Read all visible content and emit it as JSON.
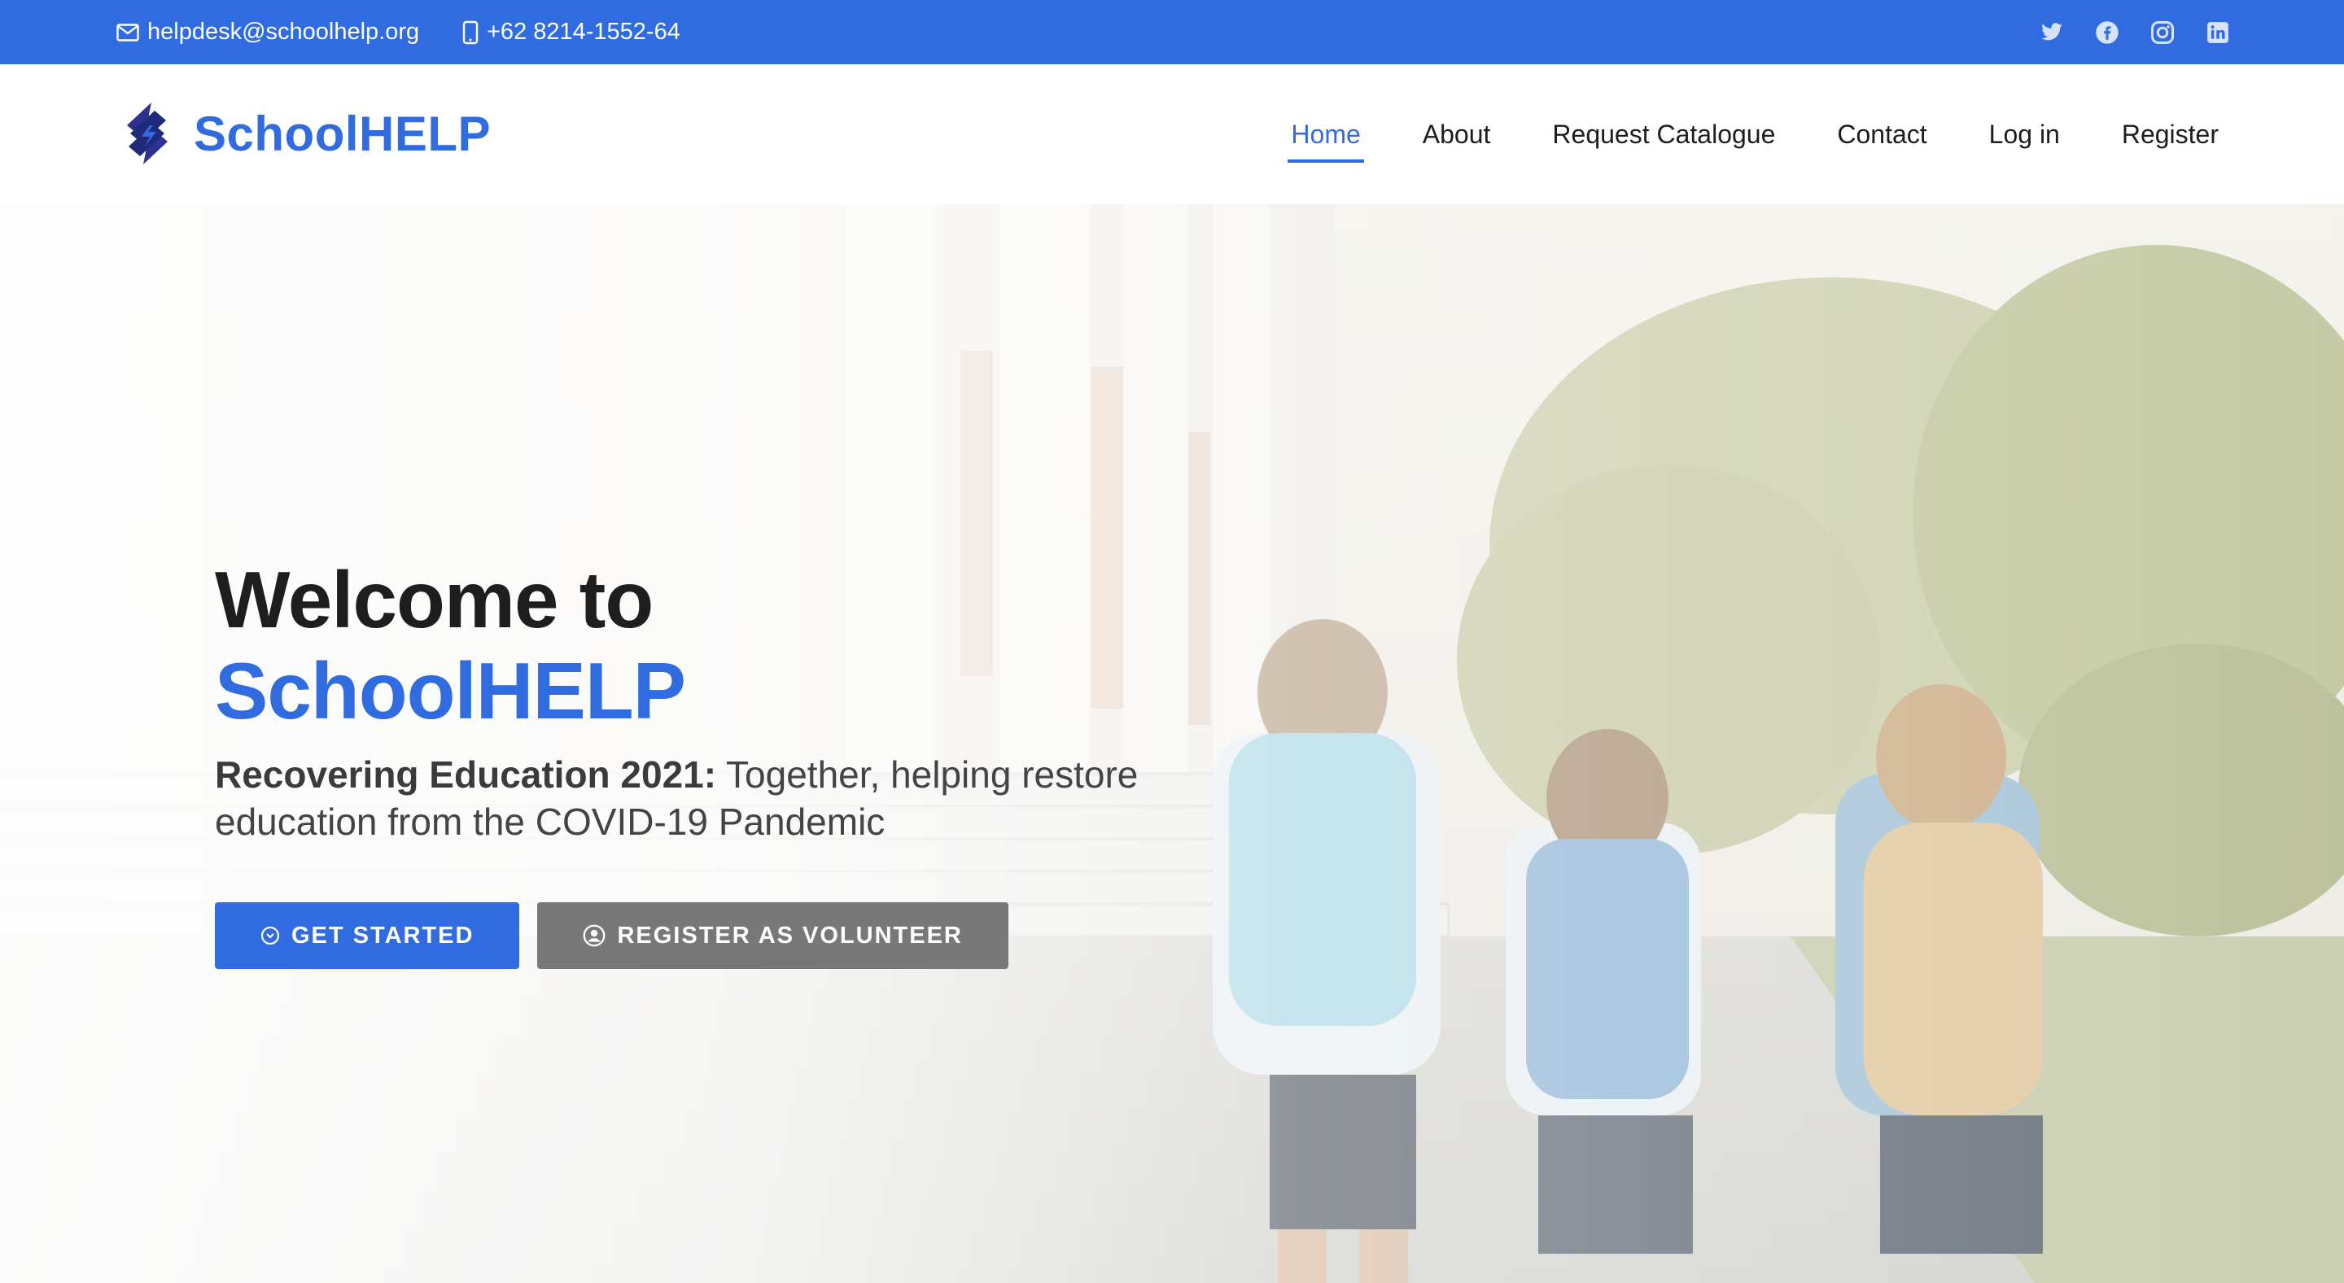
{
  "topbar": {
    "email": "helpdesk@schoolhelp.org",
    "phone": "+62 8214-1552-64",
    "email_icon": "envelope-icon",
    "phone_icon": "phone-icon",
    "social": [
      "twitter-icon",
      "facebook-icon",
      "instagram-icon",
      "linkedin-icon"
    ]
  },
  "header": {
    "brand": "SchoolHELP",
    "nav": [
      {
        "label": "Home",
        "active": true
      },
      {
        "label": "About"
      },
      {
        "label": "Request Catalogue"
      },
      {
        "label": "Contact"
      },
      {
        "label": "Log in"
      },
      {
        "label": "Register"
      }
    ]
  },
  "hero": {
    "title_line1": "Welcome to",
    "title_line2": "SchoolHELP",
    "subtitle_bold": "Recovering Education 2021:",
    "subtitle_rest": "Together, helping restore education from the COVID-19 Pandemic",
    "btn_primary": "GET STARTED",
    "btn_secondary": "REGISTER AS VOLUNTEER"
  },
  "colors": {
    "accent": "#316be0",
    "secondary_button": "#787878"
  }
}
